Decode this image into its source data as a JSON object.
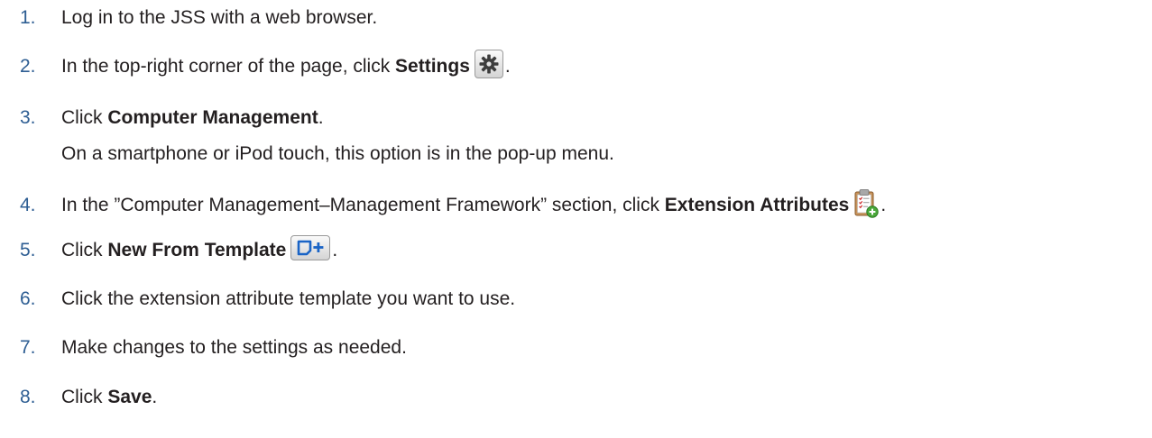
{
  "steps": [
    {
      "number": "1.",
      "text": "Log in to the JSS with a web browser."
    },
    {
      "number": "2.",
      "prefix": "In the top-right corner of the page, click ",
      "bold": "Settings",
      "icon": "gear-icon",
      "suffix": "."
    },
    {
      "number": "3.",
      "prefix": "Click ",
      "bold": "Computer Management",
      "suffix": ".",
      "subtext": "On a smartphone or iPod touch, this option is in the pop-up menu."
    },
    {
      "number": "4.",
      "prefix": "In the ”Computer Management–Management Framework” section, click ",
      "bold": "Extension Attributes",
      "icon": "clipboard-add-icon",
      "suffix": "."
    },
    {
      "number": "5.",
      "prefix": "Click ",
      "bold": "New From Template",
      "icon": "new-template-icon",
      "suffix": "."
    },
    {
      "number": "6.",
      "text": "Click the extension attribute template you want to use."
    },
    {
      "number": "7.",
      "text": "Make changes to the settings as needed."
    },
    {
      "number": "8.",
      "prefix": "Click ",
      "bold": "Save",
      "suffix": "."
    }
  ],
  "colors": {
    "number": "#2e5e93",
    "text": "#231f20",
    "icon_blue": "#1a64c6"
  }
}
